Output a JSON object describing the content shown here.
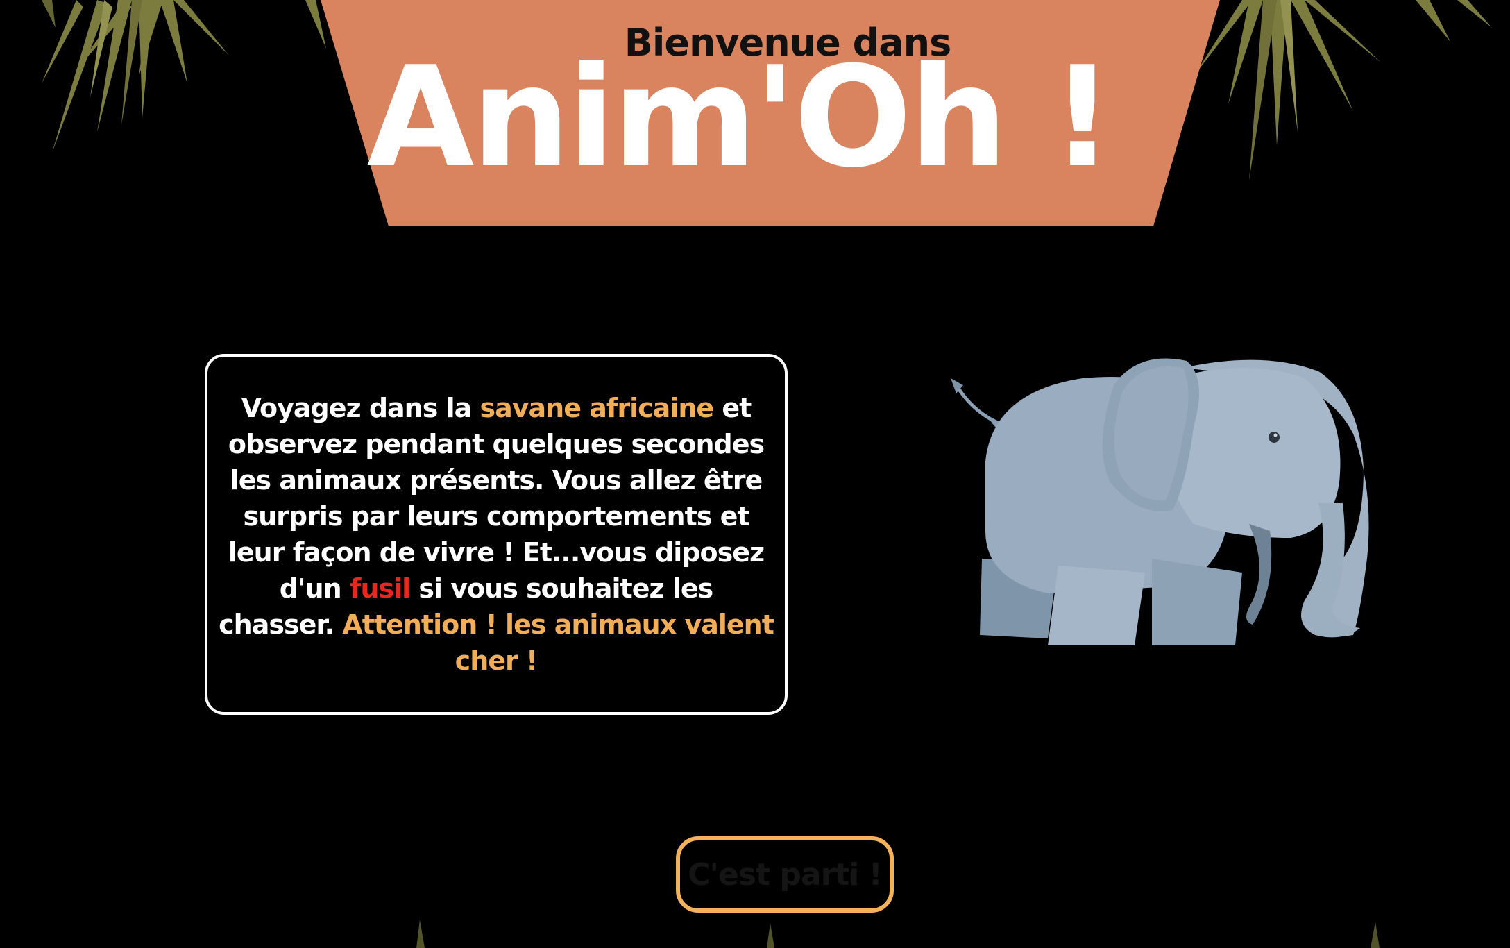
{
  "banner": {
    "subtitle": "Bienvenue dans",
    "title": "Anim'Oh !"
  },
  "intro": {
    "part1": "Voyagez dans la ",
    "highlight_savane": "savane africaine",
    "part2": " et observez pendant quelques secondes les animaux présents. Vous allez être surpris par leurs comportements et leur façon de vivre ! Et...vous diposez d'un ",
    "highlight_fusil": "fusil",
    "part3": " si vous souhaitez les chasser. ",
    "warning": "Attention ! les animaux valent cher !"
  },
  "start_button": {
    "label": "C'est parti !"
  },
  "icons": {
    "animal": "elephant-icon",
    "decoration": "grass-icon"
  },
  "colors": {
    "background": "#000000",
    "banner": "#d9845e",
    "highlight": "#f2ad57",
    "danger": "#e8281e",
    "button_border": "#f2b25d",
    "grass": "#9c9a4e"
  }
}
